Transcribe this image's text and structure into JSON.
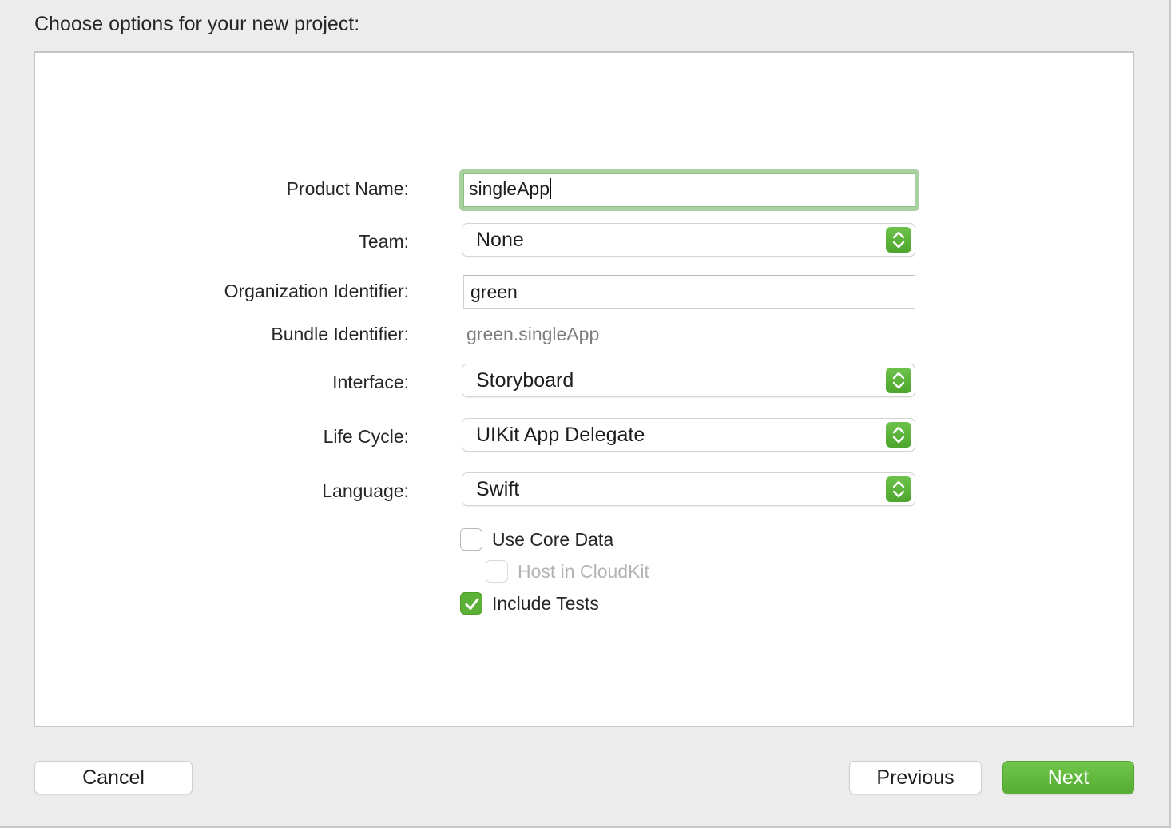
{
  "dialog": {
    "heading": "Choose options for your new project:"
  },
  "form": {
    "product_name": {
      "label": "Product Name:",
      "value": "singleApp"
    },
    "team": {
      "label": "Team:",
      "value": "None"
    },
    "organization_identifier": {
      "label": "Organization Identifier:",
      "value": "green"
    },
    "bundle_identifier": {
      "label": "Bundle Identifier:",
      "value": "green.singleApp"
    },
    "interface": {
      "label": "Interface:",
      "value": "Storyboard"
    },
    "life_cycle": {
      "label": "Life Cycle:",
      "value": "UIKit App Delegate"
    },
    "language": {
      "label": "Language:",
      "value": "Swift"
    }
  },
  "options": {
    "use_core_data": {
      "label": "Use Core Data",
      "checked": false
    },
    "host_in_cloudkit": {
      "label": "Host in CloudKit",
      "checked": false,
      "disabled": true
    },
    "include_tests": {
      "label": "Include Tests",
      "checked": true
    }
  },
  "buttons": {
    "cancel": "Cancel",
    "previous": "Previous",
    "next": "Next"
  },
  "colors": {
    "accent": "#5bb135",
    "focus_ring": "#a9d0a0",
    "panel_bg": "#ffffff",
    "window_bg": "#ececec"
  }
}
